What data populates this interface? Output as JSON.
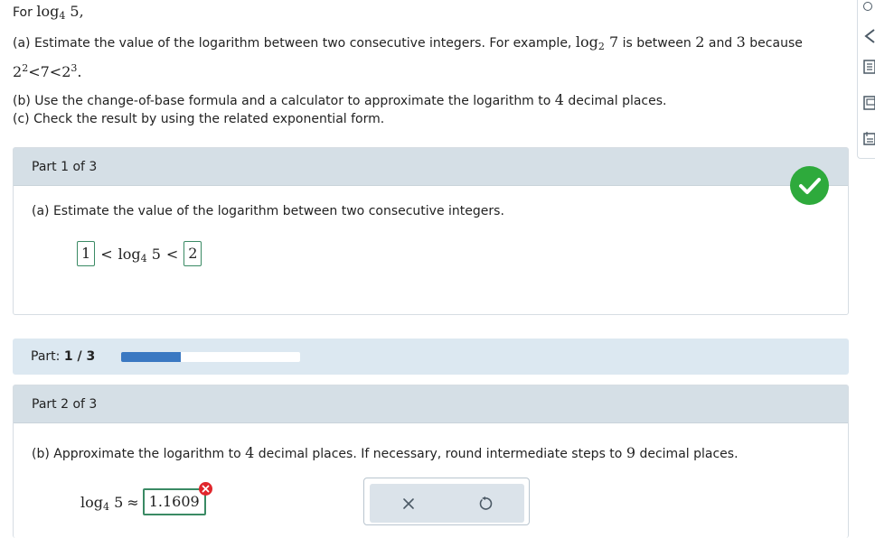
{
  "problem": {
    "intro_prefix": "For",
    "log_base": "4",
    "log_arg": "5,",
    "part_a_text": "(a) Estimate the value of the logarithm between two consecutive integers. For example,",
    "example_log_base": "2",
    "example_log_arg": "7",
    "example_between": "is between",
    "example_low": "2",
    "example_and": "and",
    "example_high": "3",
    "example_because": "because",
    "inequality_base": "2",
    "inequality_exp_low": "2",
    "inequality_mid": "7",
    "inequality_exp_high": "3",
    "part_b_text_1": "(b) Use the change-of-base formula and a calculator to approximate the logarithm to",
    "part_b_places": "4",
    "part_b_text_2": "decimal places.",
    "part_c_text": "(c) Check the result by using the related exponential form."
  },
  "part1": {
    "header": "Part 1 of 3",
    "prompt": "(a) Estimate the value of the logarithm between two consecutive integers.",
    "lower_answer": "1",
    "log_label": "log",
    "base": "4",
    "arg": "5",
    "lt": "<",
    "upper_answer": "2",
    "status": "correct"
  },
  "progress": {
    "label": "Part:",
    "current": "1",
    "separator": "/",
    "total": "3",
    "fraction_complete": 0.333
  },
  "part2": {
    "header": "Part 2 of 3",
    "prompt_1": "(b) Approximate the logarithm to",
    "places": "4",
    "prompt_2": "decimal places. If necessary, round intermediate steps to",
    "intermediate_places": "9",
    "prompt_3": "decimal places.",
    "log_label": "log",
    "base": "4",
    "arg": "5",
    "approx": "≈",
    "answer_value": "1.1609",
    "status": "incorrect"
  },
  "tools": {
    "clear_icon": "close-icon",
    "undo_icon": "undo-icon"
  },
  "colors": {
    "correct": "#2eaa3c",
    "incorrect": "#e0262c",
    "progress": "#3a78c2",
    "panel_header": "#d5dfe6",
    "progress_bg": "#dce8f1"
  }
}
